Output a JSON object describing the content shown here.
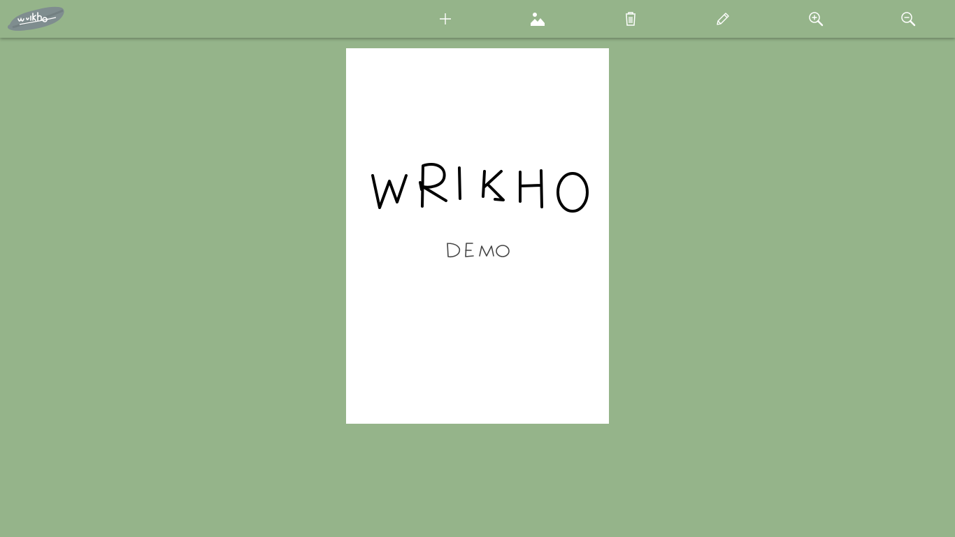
{
  "app": {
    "logo_text": "wrikho",
    "brand_color": "#95b48a"
  },
  "toolbar": {
    "buttons": [
      {
        "name": "add-page-button",
        "icon": "plus-icon"
      },
      {
        "name": "insert-image-button",
        "icon": "image-icon"
      },
      {
        "name": "delete-button",
        "icon": "trash-icon"
      },
      {
        "name": "pen-button",
        "icon": "pencil-icon"
      },
      {
        "name": "zoom-in-button",
        "icon": "zoom-in-icon"
      },
      {
        "name": "zoom-out-button",
        "icon": "zoom-out-icon"
      }
    ]
  },
  "canvas": {
    "page_background": "#ffffff",
    "handwritten_title": "WRIKHO",
    "handwritten_subtitle": "DEMO"
  }
}
